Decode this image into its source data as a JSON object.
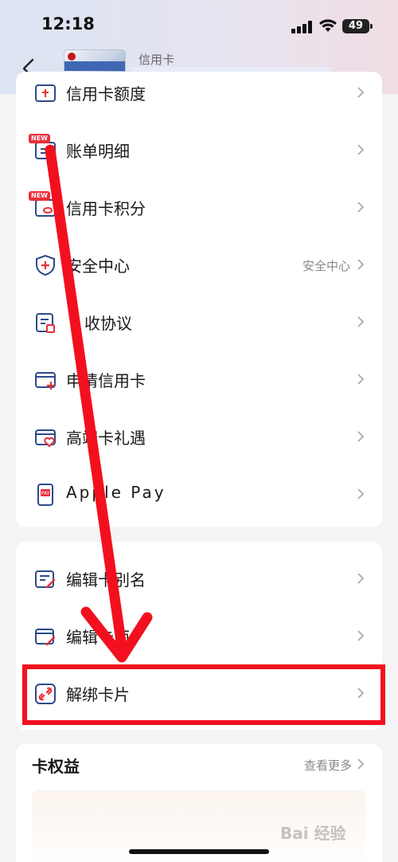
{
  "status_bar": {
    "time": "12:18",
    "battery": "49"
  },
  "header": {
    "card_type": "信用卡"
  },
  "group1": {
    "items": [
      {
        "label": "信用卡额度"
      },
      {
        "label": "账单明细",
        "badge": "NEW"
      },
      {
        "label": "信用卡积分",
        "badge": "NEW"
      },
      {
        "label": "安全中心",
        "extra": "安全中心"
      },
      {
        "label": "收协议"
      },
      {
        "label": "申请信用卡"
      },
      {
        "label": "高端卡礼遇"
      },
      {
        "label": "Apple Pay"
      }
    ]
  },
  "group2": {
    "items": [
      {
        "label": "编辑卡别名"
      },
      {
        "label": "编辑卡面"
      },
      {
        "label": "解绑卡片"
      }
    ]
  },
  "benefits": {
    "title": "卡权益",
    "more": "查看更多"
  },
  "watermark": "Bai 经验",
  "colors": {
    "annotation_red": "#f2101e",
    "accent_blue": "#2d4a8a",
    "accent_red": "#e8303a"
  }
}
